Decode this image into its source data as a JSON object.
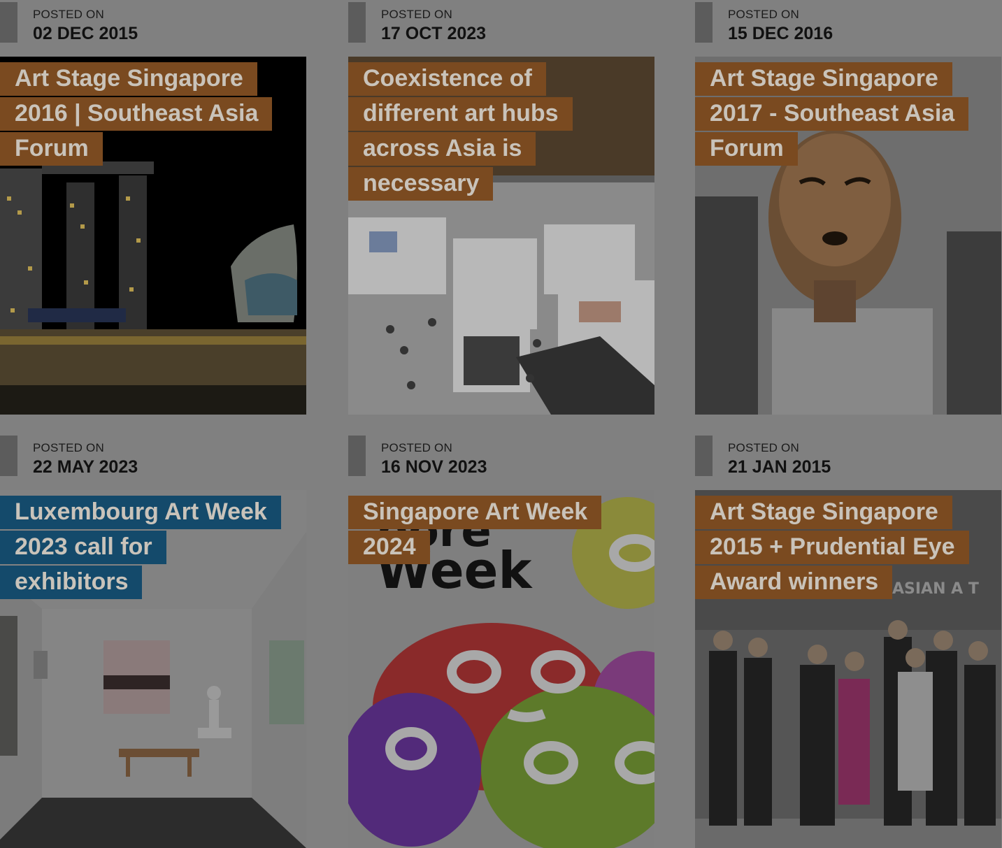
{
  "colors": {
    "page_overlay": "#808080",
    "accent_brown": "#7a4a20",
    "accent_blue": "#144a6b",
    "title_text": "#c9c3ba"
  },
  "posts": [
    {
      "posted_label": "POSTED ON",
      "date": "02 DEC 2015",
      "title": "Art Stage Singapore 2016 | Southeast Asia Forum",
      "accent": "#7a4a20",
      "image": "marina-bay-night-photo"
    },
    {
      "posted_label": "POSTED ON",
      "date": "17 OCT 2023",
      "title": "Coexistence of different art hubs across Asia is necessary",
      "accent": "#7a4a20",
      "image": "art-fair-hall-photo"
    },
    {
      "posted_label": "POSTED ON",
      "date": "15 DEC 2016",
      "title": "Art Stage Singapore 2017 - Southeast Asia Forum",
      "accent": "#7a4a20",
      "image": "wooden-head-sculpture-photo"
    },
    {
      "posted_label": "POSTED ON",
      "date": "22 MAY 2023",
      "title": "Luxembourg Art Week 2023 call for exhibitors",
      "accent": "#144a6b",
      "image": "gallery-booth-photo"
    },
    {
      "posted_label": "POSTED ON",
      "date": "16 NOV 2023",
      "title": "Singapore Art Week 2024",
      "accent": "#7a4a20",
      "image": "art-week-poster",
      "poster_text_top": "pore",
      "poster_text_main": "Week"
    },
    {
      "posted_label": "POSTED ON",
      "date": "21 JAN 2015",
      "title": "Art Stage Singapore 2015 + Prudential Eye Award winners",
      "accent": "#7a4a20",
      "image": "award-winners-photo",
      "backdrop_text": "ASIAN A T"
    }
  ]
}
